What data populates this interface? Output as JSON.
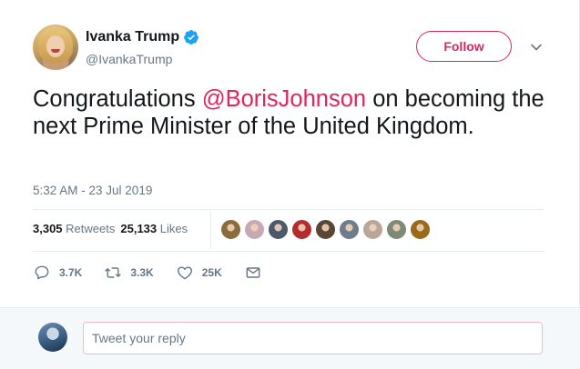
{
  "author": {
    "display_name": "Ivanka Trump",
    "handle": "@IvankaTrump",
    "verified": true
  },
  "follow_label": "Follow",
  "tweet": {
    "text_before": "Congratulations ",
    "mention": "@BorisJohnson",
    "text_after": " on becoming the next Prime Minister of the United Kingdom.",
    "timestamp": "5:32 AM - 23 Jul 2019"
  },
  "stats": {
    "retweets_count": "3,305",
    "retweets_label": "Retweets",
    "likes_count": "25,133",
    "likes_label": "Likes"
  },
  "liker_avatars": [
    {
      "icon": "user-avatar",
      "color": "#8a6d3b"
    },
    {
      "icon": "user-avatar",
      "color": "#c9a8b5"
    },
    {
      "icon": "user-avatar",
      "color": "#4a5a6a"
    },
    {
      "icon": "user-avatar",
      "color": "#b32d2e"
    },
    {
      "icon": "user-avatar",
      "color": "#5a4636"
    },
    {
      "icon": "user-avatar",
      "color": "#6d7d8c"
    },
    {
      "icon": "user-avatar",
      "color": "#b9a59a"
    },
    {
      "icon": "user-avatar",
      "color": "#7d8a77"
    },
    {
      "icon": "user-avatar",
      "color": "#9a6a1a"
    }
  ],
  "actions": {
    "reply_count": "3.7K",
    "retweet_count": "3.3K",
    "like_count": "25K"
  },
  "reply": {
    "placeholder": "Tweet your reply"
  },
  "colors": {
    "accent": "#e0245e",
    "verified": "#1da1f2",
    "secondary_text": "#657786"
  }
}
